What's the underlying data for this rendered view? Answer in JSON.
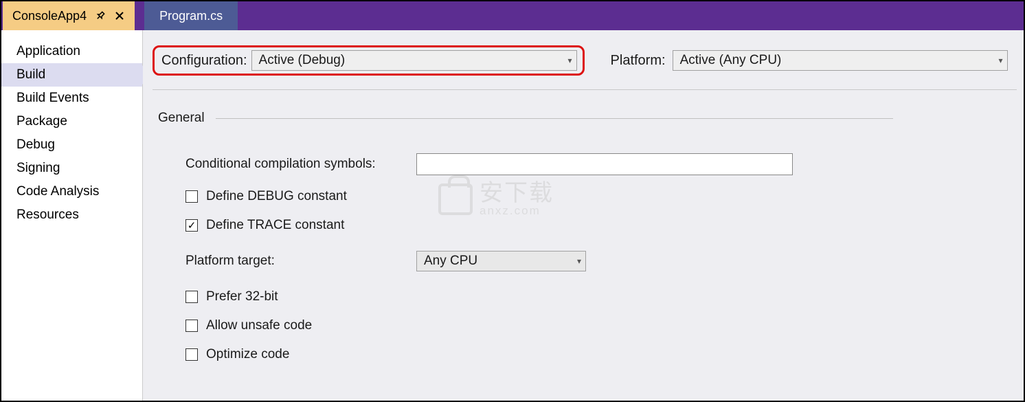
{
  "tabs": {
    "active": "ConsoleApp4",
    "other": "Program.cs"
  },
  "sidebar": {
    "items": [
      "Application",
      "Build",
      "Build Events",
      "Package",
      "Debug",
      "Signing",
      "Code Analysis",
      "Resources"
    ],
    "selected_index": 1
  },
  "top": {
    "config_label": "Configuration:",
    "config_value": "Active (Debug)",
    "platform_label": "Platform:",
    "platform_value": "Active (Any CPU)"
  },
  "section": {
    "general": "General"
  },
  "general": {
    "cond_label": "Conditional compilation symbols:",
    "cond_value": "",
    "debug_label": "Define DEBUG constant",
    "debug_checked": false,
    "trace_label": "Define TRACE constant",
    "trace_checked": true,
    "plat_target_label": "Platform target:",
    "plat_target_value": "Any CPU",
    "prefer32_label": "Prefer 32-bit",
    "prefer32_checked": false,
    "unsafe_label": "Allow unsafe code",
    "unsafe_checked": false,
    "optimize_label": "Optimize code",
    "optimize_checked": false
  },
  "watermark": {
    "line1": "安下载",
    "line2": "anxz.com"
  }
}
